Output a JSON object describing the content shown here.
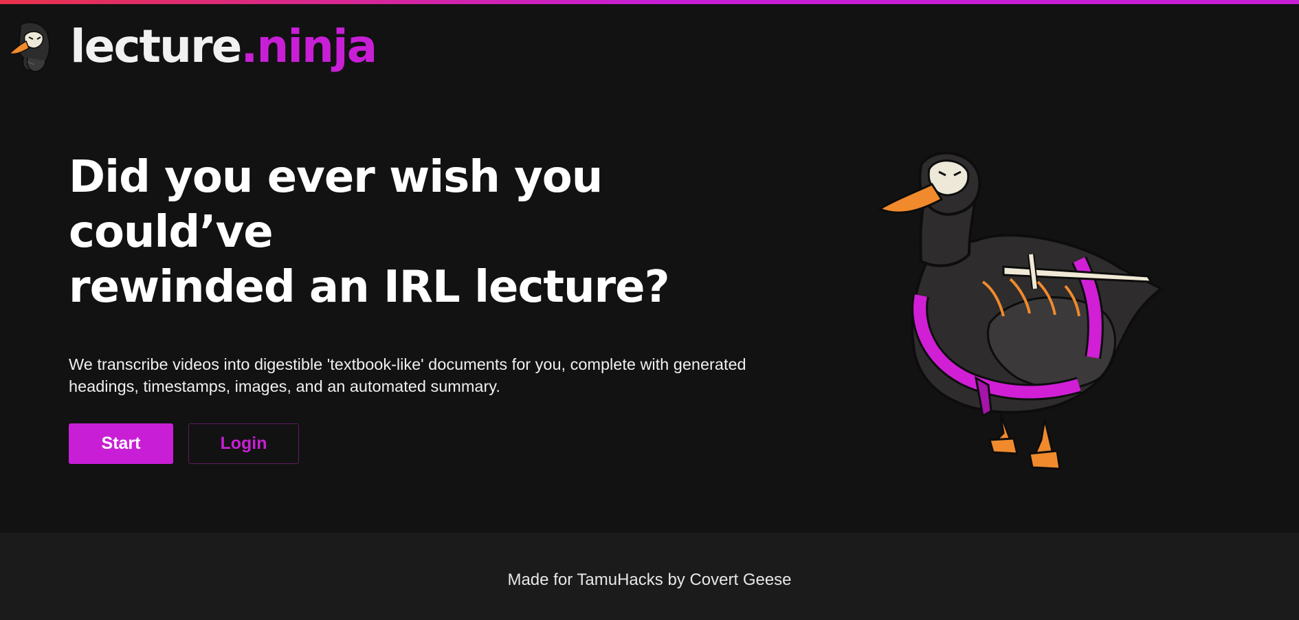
{
  "brand": {
    "name_part1": "lecture",
    "name_part2": ".ninja",
    "icon": "ninja-goose-icon",
    "accent_color": "#c81fd6",
    "gradient_start": "#e8324a",
    "gradient_end": "#c81fd6"
  },
  "hero": {
    "headline_line1": "Did you ever wish you could’ve",
    "headline_line2": "rewinded an IRL lecture?",
    "description_line1": "We transcribe videos into digestible 'textbook-like' documents for you, complete with generated",
    "description_line2": "headings, timestamps, images, and an automated summary.",
    "start_label": "Start",
    "login_label": "Login",
    "illustration": "ninja-goose-illustration"
  },
  "footer": {
    "text": "Made for TamuHacks by Covert Geese"
  },
  "colors": {
    "background": "#121212",
    "footer_background": "#1b1b1b",
    "text": "#ffffff"
  }
}
